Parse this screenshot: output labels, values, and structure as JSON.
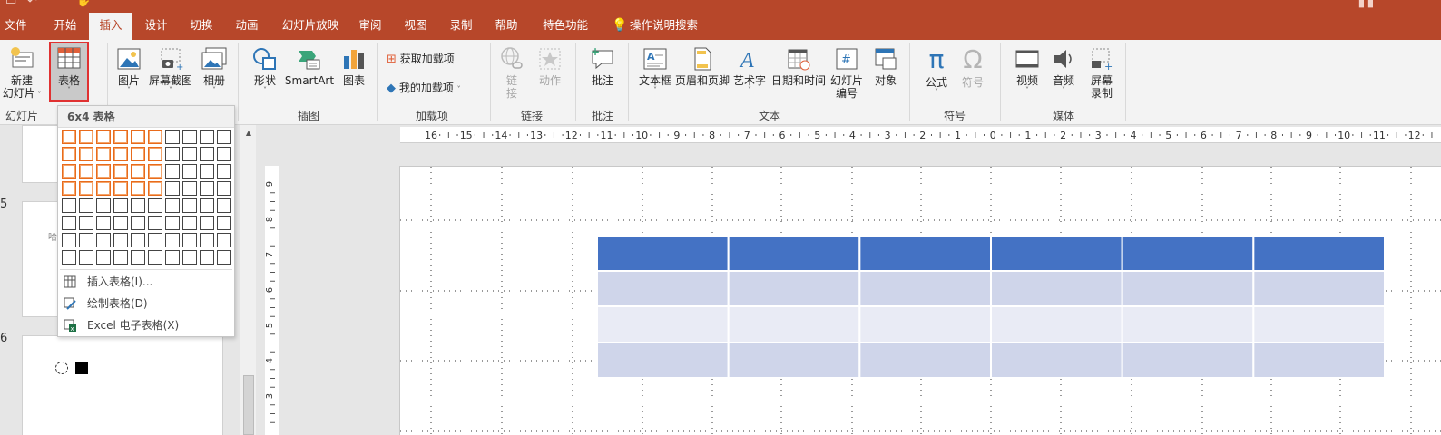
{
  "tabs": [
    "文件",
    "开始",
    "插入",
    "设计",
    "切换",
    "动画",
    "幻灯片放映",
    "审阅",
    "视图",
    "录制",
    "帮助",
    "特色功能"
  ],
  "active_tab": "插入",
  "tell_me": "操作说明搜索",
  "ribbon": {
    "new_slide": {
      "line1": "新建",
      "line2": "幻灯片"
    },
    "table": "表格",
    "picture": "图片",
    "screenshot": "屏幕截图",
    "album": "相册",
    "shapes": "形状",
    "smartart": "SmartArt",
    "chart": "图表",
    "get_addins": "获取加载项",
    "my_addins": "我的加载项",
    "link": {
      "line1": "链",
      "line2": "接"
    },
    "action": "动作",
    "comment": "批注",
    "textbox": "文本框",
    "header_footer": "页眉和页脚",
    "wordart": "艺术字",
    "datetime": "日期和时间",
    "slide_number": {
      "line1": "幻灯片",
      "line2": "编号"
    },
    "object": "对象",
    "equation": "公式",
    "symbol": "符号",
    "video": "视频",
    "audio": "音频",
    "screen_record": {
      "line1": "屏幕",
      "line2": "录制"
    },
    "groups": {
      "slides": "幻灯片",
      "images": "插图",
      "addins": "加载项",
      "links": "链接",
      "comments": "批注",
      "text": "文本",
      "symbols": "符号",
      "media": "媒体"
    }
  },
  "dropdown": {
    "header": "6x4 表格",
    "grid_cols": 10,
    "grid_rows": 8,
    "selected_cols": 6,
    "selected_rows": 4,
    "items": [
      "插入表格(I)...",
      "绘制表格(D)",
      "Excel 电子表格(X)"
    ]
  },
  "thumbnails": {
    "numbers": [
      "5",
      "6"
    ],
    "thumb5_text": "哈"
  },
  "ruler": {
    "top_labels": [
      "16",
      "15",
      "14",
      "13",
      "12",
      "11",
      "10",
      "9",
      "8",
      "7",
      "6",
      "5",
      "4",
      "3",
      "2",
      "1",
      "0",
      "1",
      "2",
      "3",
      "4",
      "5",
      "6",
      "7",
      "8",
      "9",
      "10",
      "11",
      "12"
    ],
    "left_labels": [
      "9",
      "8",
      "7",
      "6",
      "5",
      "4",
      "3"
    ]
  },
  "slide_table": {
    "cols": 6,
    "rows": 4,
    "header_color": "#4472c4",
    "band_colors": [
      "#cfd5ea",
      "#e9ebf5"
    ]
  },
  "colors": {
    "accent": "#b7472a",
    "selection": "#e86b1c",
    "highlight_box": "#e03131"
  }
}
